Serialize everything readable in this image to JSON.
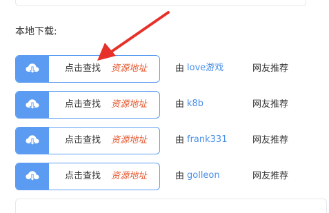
{
  "section": {
    "title": "本地下载:"
  },
  "rows": [
    {
      "action": "点击查找",
      "link": "资源地址",
      "by": "由",
      "provider": "love游戏",
      "note": "网友推荐"
    },
    {
      "action": "点击查找",
      "link": "资源地址",
      "by": "由",
      "provider": "k8b",
      "note": "网友推荐"
    },
    {
      "action": "点击查找",
      "link": "资源地址",
      "by": "由",
      "provider": "frank331",
      "note": "网友推荐"
    },
    {
      "action": "点击查找",
      "link": "资源地址",
      "by": "由",
      "provider": "golleon",
      "note": "网友推荐"
    }
  ],
  "icons": {
    "download": "cloud-download-icon",
    "annotation": "red-arrow"
  },
  "colors": {
    "button_border": "#5b9cf2",
    "icon_bg": "#5b9cf2",
    "link_red": "#e4572e",
    "provider_blue": "#4a8fe7",
    "arrow_red": "#e8302a"
  }
}
